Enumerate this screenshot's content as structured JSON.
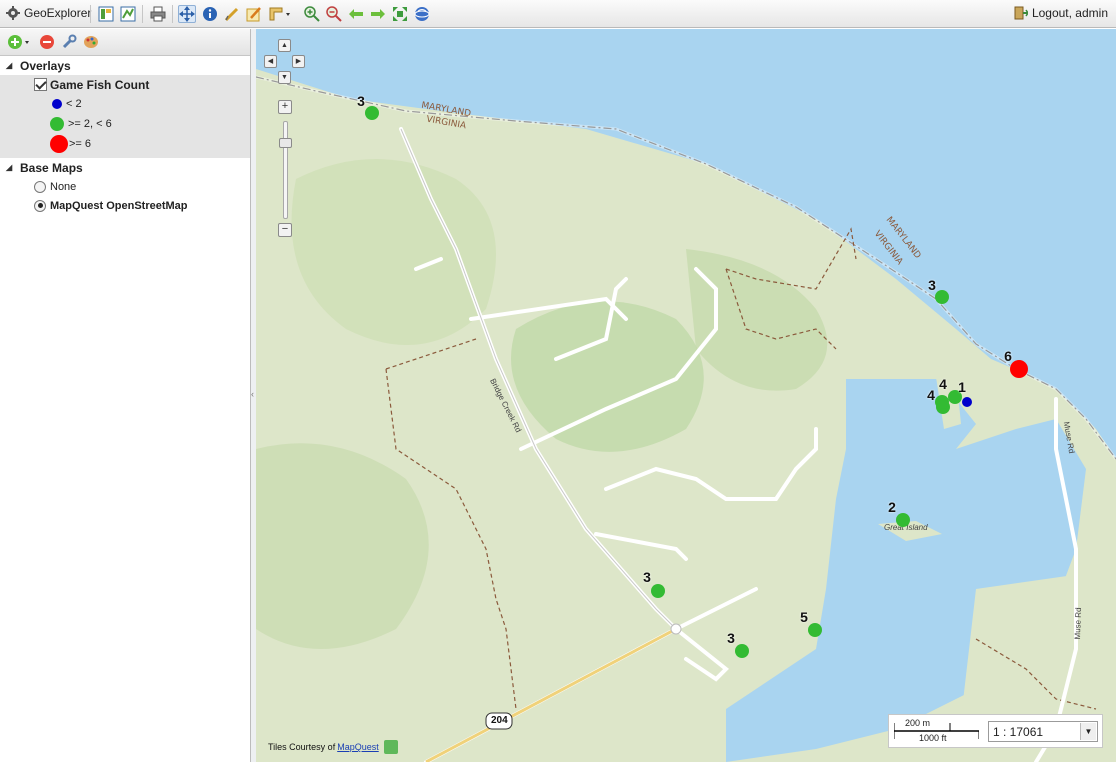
{
  "app": {
    "title": "GeoExplorer",
    "logout_label": "Logout, admin"
  },
  "toolbar": {
    "icons": [
      "layers-icon",
      "export-map-icon",
      "print-icon",
      "pan-icon",
      "info-icon",
      "measure-icon",
      "edit-icon",
      "ruler-icon",
      "zoom-in-icon",
      "zoom-out-icon",
      "back-icon",
      "forward-icon",
      "zoom-extent-icon",
      "globe-icon"
    ],
    "active": "pan-icon"
  },
  "sidebar": {
    "overlays_title": "Overlays",
    "layer": {
      "label": "Game Fish Count",
      "checked": true
    },
    "legend": [
      {
        "label": "< 2",
        "color": "#0000cc",
        "size": 10
      },
      {
        "label": ">= 2, < 6",
        "color": "#33bb33",
        "size": 14
      },
      {
        "label": ">= 6",
        "color": "#ff0000",
        "size": 18
      }
    ],
    "basemaps_title": "Base Maps",
    "basemaps": [
      {
        "label": "None",
        "selected": false
      },
      {
        "label": "MapQuest OpenStreetMap",
        "selected": true
      }
    ]
  },
  "map": {
    "labels": {
      "maryland": "MARYLAND",
      "virginia": "VIRGINIA",
      "maryland2": "MARYLAND",
      "virginia2": "VIRGINIA",
      "bridge_creek": "Bridge Creek Rd",
      "muse_rd": "Muse Rd",
      "muse_rd2": "Muse Rd",
      "great_island": "Great Island",
      "route": "204"
    },
    "attribution_prefix": "Tiles Courtesy of",
    "attribution_link": "MapQuest",
    "scale": {
      "metric": "200 m",
      "imperial": "1000 ft",
      "ratio": "1 : 17061"
    },
    "points": [
      {
        "count": "3",
        "class": "mid"
      },
      {
        "count": "3",
        "class": "mid"
      },
      {
        "count": "6",
        "class": "high"
      },
      {
        "count": "4",
        "class": "mid"
      },
      {
        "count": "4",
        "class": "mid"
      },
      {
        "count": "1",
        "class": "low"
      },
      {
        "count": "2",
        "class": "mid"
      },
      {
        "count": "3",
        "class": "mid"
      },
      {
        "count": "5",
        "class": "mid"
      },
      {
        "count": "3",
        "class": "mid"
      }
    ]
  }
}
